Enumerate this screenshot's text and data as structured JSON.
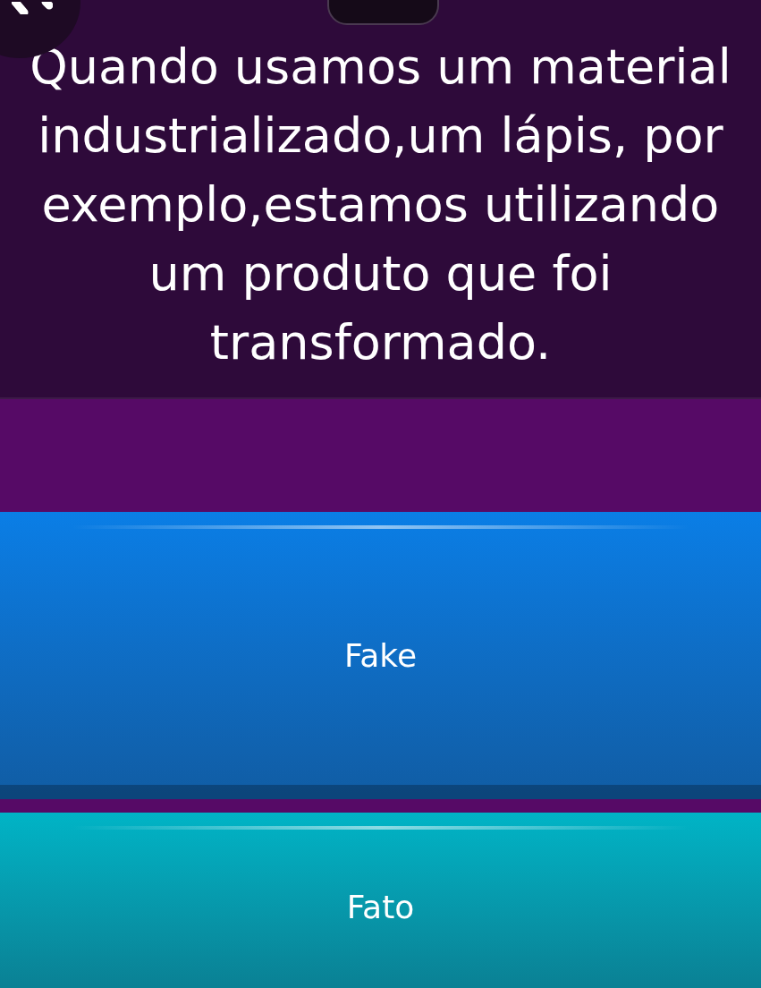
{
  "question": {
    "text": "Quando usamos um material industrializado,um lápis, por exemplo,estamos utilizando um produto que foi transformado."
  },
  "answers": [
    {
      "label": "Fake",
      "color": "#0a7ee6"
    },
    {
      "label": "Fato",
      "color": "#00b4c6"
    }
  ]
}
